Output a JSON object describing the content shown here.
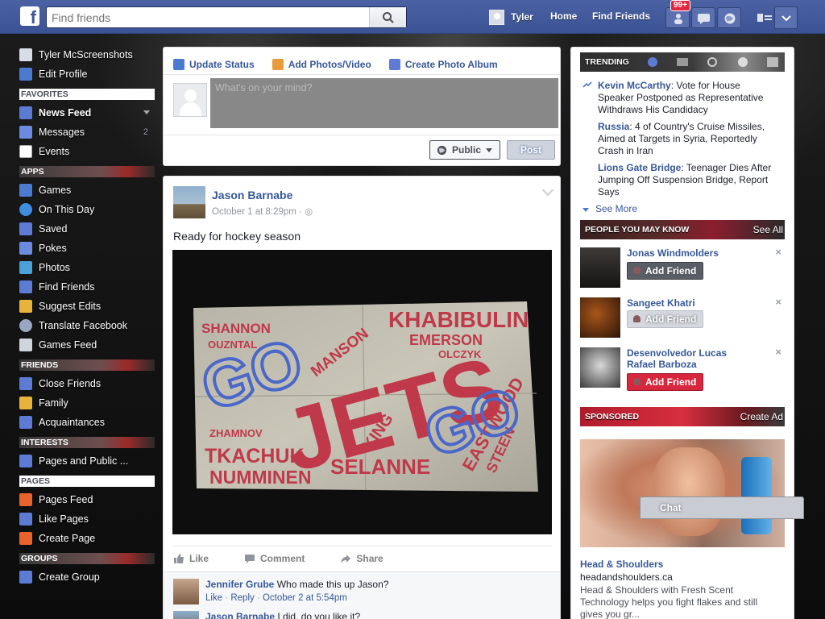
{
  "topbar": {
    "logo": "f",
    "search_placeholder": "Find friends",
    "user_name": "Tyler",
    "home": "Home",
    "find_friends": "Find Friends",
    "notification_count": "99+"
  },
  "sidebar": {
    "user": "Tyler McScreenshots",
    "edit_profile": "Edit Profile",
    "favorites_head": "FAVORITES",
    "favorites": [
      {
        "label": "News Feed",
        "count": ""
      },
      {
        "label": "Messages",
        "count": "2"
      },
      {
        "label": "Events",
        "count": ""
      }
    ],
    "apps_head": "APPS",
    "apps": [
      "Games",
      "On This Day",
      "Saved",
      "Pokes",
      "Photos",
      "Find Friends",
      "Suggest Edits",
      "Translate Facebook",
      "Games Feed"
    ],
    "friends_head": "FRIENDS",
    "friends": [
      "Close Friends",
      "Family",
      "Acquaintances"
    ],
    "interests_head": "INTERESTS",
    "interests": [
      "Pages and Public ..."
    ],
    "pages_head": "PAGES",
    "pages": [
      "Pages Feed",
      "Like Pages",
      "Create Page"
    ],
    "groups_head": "GROUPS",
    "groups": [
      "Create Group"
    ]
  },
  "composer": {
    "tab_status": "Update Status",
    "tab_photos": "Add Photos/Video",
    "tab_album": "Create Photo Album",
    "placeholder": "What's on your mind?",
    "privacy": "Public",
    "post": "Post"
  },
  "post": {
    "author": "Jason Barnabe",
    "time": "October 1 at 8:29pm",
    "text": "Ready for hockey season",
    "sign_words": [
      "SHANNON",
      "OUZNTAL",
      "MANSON",
      "KHABIBULIN",
      "EMERSON",
      "OLCZYK",
      "GO",
      "JETS",
      "GO",
      "ZHAMNOV",
      "TKACHUK",
      "NUMMINEN",
      "KING",
      "SELANNE",
      "EASTWOOD",
      "STEEN"
    ],
    "like": "Like",
    "comment": "Comment",
    "share": "Share",
    "comments": [
      {
        "name": "Jennifer Grube",
        "body": "Who made this up Jason?",
        "like": "Like",
        "reply": "Reply",
        "time": "October 2 at 5:54pm"
      },
      {
        "name": "Jason Barnabe",
        "body": "I did, do you like it?"
      }
    ]
  },
  "right": {
    "trending_head": "TRENDING",
    "trending": [
      {
        "title": "Kevin McCarthy",
        "text": ": Vote for House Speaker Postponed as Representative Withdraws His Candidacy"
      },
      {
        "title": "Russia",
        "text": ": 4 of Country's Cruise Missiles, Aimed at Targets in Syria, Reportedly Crash in Iran"
      },
      {
        "title": "Lions Gate Bridge",
        "text": ": Teenager Dies After Jumping Off Suspension Bridge, Report Says"
      }
    ],
    "see_more": "See More",
    "pymk_head": "PEOPLE YOU MAY KNOW",
    "see_all": "See All",
    "people": [
      {
        "name": "Jonas Windmolders",
        "button": "Add Friend"
      },
      {
        "name": "Sangeet Khatri",
        "button": "Add Friend"
      },
      {
        "name": "Desenvolvedor Lucas Rafael Barboza",
        "button": "Add Friend"
      }
    ],
    "sponsored_head": "SPONSORED",
    "create_ad": "Create Ad",
    "ad_title": "Head & Shoulders",
    "ad_url": "headandshoulders.ca",
    "ad_text": "Head & Shoulders with Fresh Scent Technology helps you fight flakes and still gives you gr...",
    "chat": "Chat"
  }
}
